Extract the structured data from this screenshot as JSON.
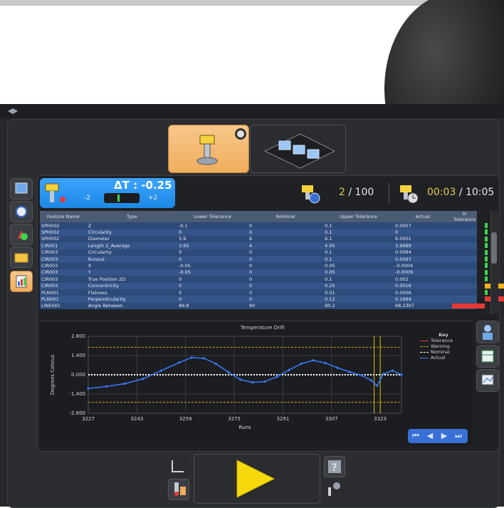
{
  "delta_t": {
    "label": "ΔT : -0.25",
    "min": "-2",
    "max": "+2",
    "level": 0.44
  },
  "runs": {
    "current": "2",
    "sep": "/",
    "total": "100"
  },
  "time": {
    "elapsed": "00:03",
    "sep": "/",
    "total": "10:05"
  },
  "table": {
    "headers": [
      "Feature Name",
      "Type",
      "Lower Tolerance",
      "Nominal",
      "Upper Tolerance",
      "Actual",
      "In Tolerance"
    ],
    "rows": [
      [
        "SPH002",
        "Z",
        "-0.1",
        "0",
        "0.1",
        "0.0057",
        ""
      ],
      [
        "SPH002",
        "Circularity",
        "0",
        "0",
        "0.1",
        "0",
        ""
      ],
      [
        "SPH002",
        "Diameter",
        "5.9",
        "6",
        "6.1",
        "6.0001",
        ""
      ],
      [
        "CIR001",
        "Length 2_Average",
        "3.95",
        "4",
        "4.05",
        "3.9989",
        ""
      ],
      [
        "CIR003",
        "Circularity",
        "0",
        "0",
        "0.1",
        "0.0094",
        ""
      ],
      [
        "CIR003",
        "Runout",
        "0",
        "0",
        "0.1",
        "0.0097",
        ""
      ],
      [
        "CIR003",
        "X",
        "-0.05",
        "0",
        "0.05",
        "-0.0004",
        ""
      ],
      [
        "CIR003",
        "Y",
        "-0.05",
        "0",
        "0.05",
        "-0.0009",
        ""
      ],
      [
        "CIR003",
        "True Position 2D",
        "0",
        "0",
        "0.1",
        "0.002",
        ""
      ],
      [
        "CIR003",
        "Concentricity",
        "0",
        "0",
        "0.25",
        "0.0016",
        ""
      ],
      [
        "PLN001",
        "Flatness",
        "0",
        "0",
        "0.01",
        "0.0006",
        ""
      ],
      [
        "PLN001",
        "Perpendicularity",
        "0",
        "0",
        "0.12",
        "0.1994",
        ""
      ],
      [
        "LINE001",
        "Angle Between",
        "89.8",
        "90",
        "90.2",
        "68.2307",
        ""
      ]
    ],
    "bar_status": [
      "green",
      "green",
      "green",
      "green",
      "green",
      "green",
      "green",
      "green",
      "green",
      "yellow",
      "green",
      "red",
      "red"
    ]
  },
  "chart_data": {
    "type": "line",
    "title": "Temperature Drift",
    "xlabel": "Runs",
    "ylabel": "Degrees Celsius",
    "xlim": [
      3227,
      3330
    ],
    "ylim": [
      -2.8,
      2.8
    ],
    "x_ticks": [
      "3227",
      "3243",
      "3259",
      "3275",
      "3291",
      "3307",
      "3323"
    ],
    "y_ticks": [
      "2.800",
      "1.400",
      "0.000",
      "-1.400",
      "-2.800"
    ],
    "series": [
      {
        "name": "Tolerance",
        "color": "#e53935",
        "values": []
      },
      {
        "name": "Warning",
        "color": "#e6a100",
        "constant": [
          2.0,
          -2.0
        ]
      },
      {
        "name": "Nominal",
        "color": "#ffffff",
        "constant": [
          0
        ]
      },
      {
        "name": "Actual",
        "color": "#3b7bff",
        "x": [
          3227,
          3233,
          3239,
          3245,
          3251,
          3257,
          3261,
          3265,
          3269,
          3273,
          3277,
          3281,
          3285,
          3289,
          3293,
          3297,
          3301,
          3305,
          3309,
          3313,
          3317,
          3320,
          3322,
          3324,
          3327,
          3330
        ],
        "y": [
          -1.0,
          -0.85,
          -0.65,
          -0.3,
          0.3,
          0.9,
          1.25,
          1.2,
          0.8,
          0.2,
          -0.35,
          -0.55,
          -0.5,
          -0.15,
          0.35,
          0.8,
          1.05,
          0.85,
          0.5,
          0.2,
          -0.05,
          -0.4,
          -0.8,
          0.05,
          0.3,
          0.0
        ]
      }
    ],
    "key": {
      "title": "Key",
      "items": [
        "Tolerance",
        "Warning",
        "Nominal",
        "Actual"
      ]
    }
  },
  "colors": {
    "accent_orange": "#f0ad5e",
    "delta_blue": "#1e88e5",
    "highlight_yellow": "#e2c84f"
  }
}
